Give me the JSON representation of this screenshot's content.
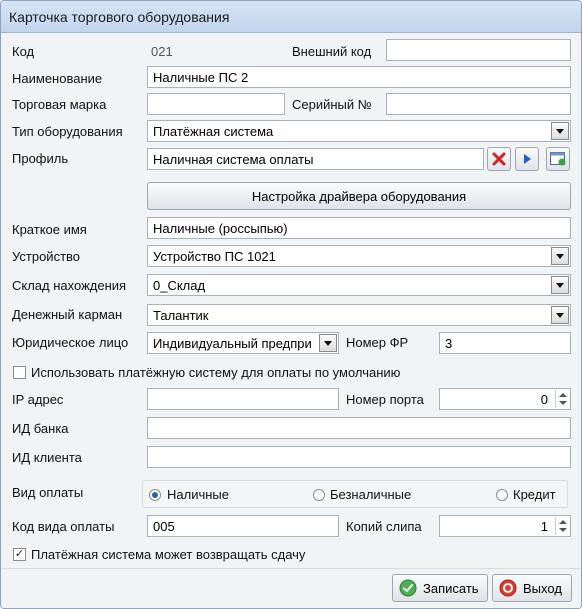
{
  "window": {
    "title": "Карточка торгового оборудования"
  },
  "fields": {
    "code_label": "Код",
    "code_value": "021",
    "external_code_label": "Внешний код",
    "external_code_value": "",
    "name_label": "Наименование",
    "name_value": "Наличные ПС 2",
    "brand_label": "Торговая марка",
    "brand_value": "",
    "serial_label": "Серийный №",
    "serial_value": "",
    "equipment_type_label": "Тип оборудования",
    "equipment_type_value": "Платёжная система",
    "profile_label": "Профиль",
    "profile_value": "Наличная система оплаты",
    "driver_settings_button": "Настройка драйвера оборудования",
    "short_name_label": "Краткое имя",
    "short_name_value": "Наличные (россыпью)",
    "device_label": "Устройство",
    "device_value": "Устройство ПС 1021",
    "warehouse_label": "Склад нахождения",
    "warehouse_value": "0_Склад",
    "cash_pocket_label": "Денежный карман",
    "cash_pocket_value": "Талантик",
    "legal_entity_label": "Юридическое лицо",
    "legal_entity_value": "Индивидуальный предпри",
    "fr_number_label": "Номер ФР",
    "fr_number_value": "3",
    "use_default_label": "Использовать платёжную систему для оплаты по умолчанию",
    "ip_label": "IP адрес",
    "ip_value": "",
    "port_label": "Номер порта",
    "port_value": "0",
    "bank_id_label": "ИД банка",
    "bank_id_value": "",
    "client_id_label": "ИД клиента",
    "client_id_value": "",
    "payment_kind_label": "Вид оплаты",
    "payment_options": [
      "Наличные",
      "Безналичные",
      "Кредит"
    ],
    "payment_selected": "Наличные",
    "payment_code_label": "Код вида оплаты",
    "payment_code_value": "005",
    "slip_copies_label": "Копий слипа",
    "slip_copies_value": "1",
    "can_return_change_label": "Платёжная система может возвращать сдачу",
    "use_default_checked": false,
    "can_return_change_checked": true
  },
  "buttons": {
    "save": "Записать",
    "exit": "Выход"
  },
  "icons": {
    "clear": "red-x-icon",
    "select": "blue-play-icon",
    "open": "window-icon"
  }
}
